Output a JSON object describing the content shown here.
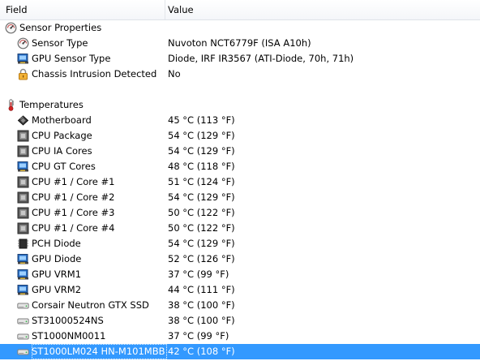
{
  "header": {
    "field": "Field",
    "value": "Value"
  },
  "groups": [
    {
      "label": "Sensor Properties",
      "icon": "sensor-icon",
      "items": [
        {
          "label": "Sensor Type",
          "value": "Nuvoton NCT6779F  (ISA A10h)",
          "icon": "sensor-icon"
        },
        {
          "label": "GPU Sensor Type",
          "value": "Diode, IRF IR3567  (ATI-Diode, 70h, 71h)",
          "icon": "gpu-icon"
        },
        {
          "label": "Chassis Intrusion Detected",
          "value": "No",
          "icon": "lock-icon"
        }
      ]
    },
    {
      "label": "Temperatures",
      "icon": "thermometer-icon",
      "items": [
        {
          "label": "Motherboard",
          "value": "45 °C  (113 °F)",
          "icon": "motherboard-icon"
        },
        {
          "label": "CPU Package",
          "value": "54 °C  (129 °F)",
          "icon": "cpu-icon"
        },
        {
          "label": "CPU IA Cores",
          "value": "54 °C  (129 °F)",
          "icon": "cpu-icon"
        },
        {
          "label": "CPU GT Cores",
          "value": "48 °C  (118 °F)",
          "icon": "gpu-icon"
        },
        {
          "label": "CPU #1 / Core #1",
          "value": "51 °C  (124 °F)",
          "icon": "cpu-icon"
        },
        {
          "label": "CPU #1 / Core #2",
          "value": "54 °C  (129 °F)",
          "icon": "cpu-icon"
        },
        {
          "label": "CPU #1 / Core #3",
          "value": "50 °C  (122 °F)",
          "icon": "cpu-icon"
        },
        {
          "label": "CPU #1 / Core #4",
          "value": "50 °C  (122 °F)",
          "icon": "cpu-icon"
        },
        {
          "label": "PCH Diode",
          "value": "54 °C  (129 °F)",
          "icon": "chip-icon"
        },
        {
          "label": "GPU Diode",
          "value": "52 °C  (126 °F)",
          "icon": "gpu-icon"
        },
        {
          "label": "GPU VRM1",
          "value": "37 °C  (99 °F)",
          "icon": "gpu-icon"
        },
        {
          "label": "GPU VRM2",
          "value": "44 °C  (111 °F)",
          "icon": "gpu-icon"
        },
        {
          "label": "Corsair Neutron GTX SSD",
          "value": "38 °C  (100 °F)",
          "icon": "drive-icon"
        },
        {
          "label": "ST31000524NS",
          "value": "38 °C  (100 °F)",
          "icon": "drive-icon"
        },
        {
          "label": "ST1000NM0011",
          "value": "37 °C  (99 °F)",
          "icon": "drive-icon"
        },
        {
          "label": "ST1000LM024 HN-M101MBB",
          "value": "42 °C  (108 °F)",
          "icon": "drive-icon",
          "selected": true
        }
      ]
    }
  ],
  "colors": {
    "selection": "#3399ff",
    "header_bg": "#f4f6f9"
  }
}
